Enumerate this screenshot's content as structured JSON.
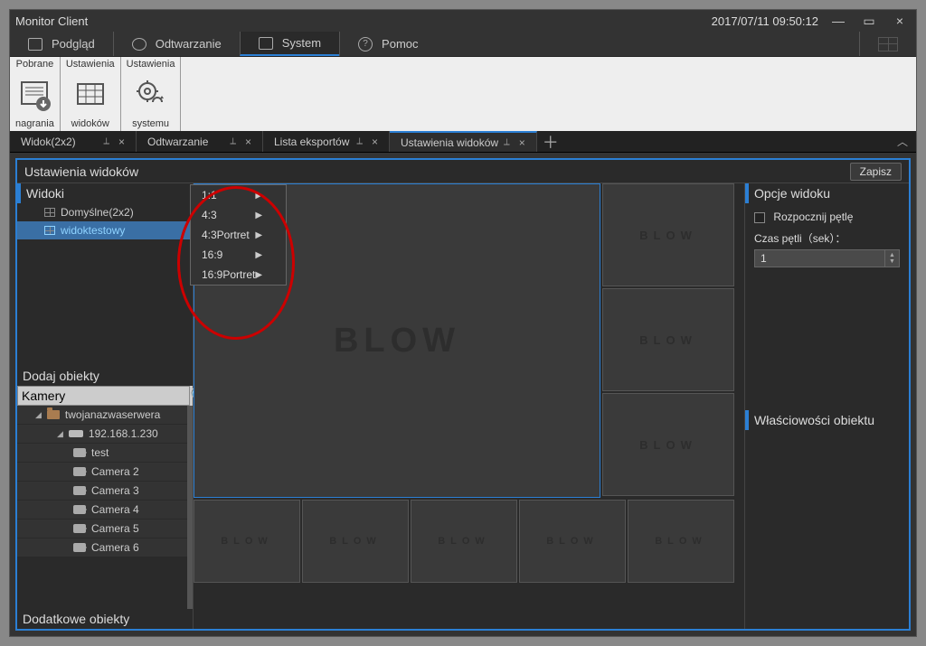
{
  "titlebar": {
    "title": "Monitor Client",
    "datetime": "2017/07/11 09:50:12"
  },
  "mainmenu": {
    "items": [
      {
        "label": "Podgląd"
      },
      {
        "label": "Odtwarzanie"
      },
      {
        "label": "System"
      },
      {
        "label": "Pomoc"
      }
    ]
  },
  "ribbon": {
    "groups": [
      {
        "top": "Pobrane",
        "bottom": "nagrania"
      },
      {
        "top": "Ustawienia",
        "bottom": "widoków"
      },
      {
        "top": "Ustawienia",
        "bottom": "systemu"
      }
    ]
  },
  "subtabs": {
    "items": [
      {
        "label": "Widok(2x2)"
      },
      {
        "label": "Odtwarzanie"
      },
      {
        "label": "Lista eksportów"
      },
      {
        "label": "Ustawienia widoków"
      }
    ]
  },
  "page": {
    "title": "Ustawienia widoków",
    "save_label": "Zapisz"
  },
  "views_panel": {
    "title": "Widoki",
    "items": [
      {
        "label": "Domyślne(2x2)"
      },
      {
        "label": "widoktestowy"
      }
    ]
  },
  "context_menu": {
    "items": [
      {
        "label": "1:1"
      },
      {
        "label": "4:3"
      },
      {
        "label": "4:3Portret"
      },
      {
        "label": "16:9"
      },
      {
        "label": "16:9Portret"
      }
    ]
  },
  "add_objects": {
    "title": "Dodaj obiekty",
    "search_placeholder": "Kamery",
    "extra_title": "Dodatkowe obiekty",
    "tree": {
      "server": "twojanazwaserwera",
      "nvr": "192.168.1.230",
      "cams": [
        "test",
        "Camera 2",
        "Camera 3",
        "Camera 4",
        "Camera 5",
        "Camera 6"
      ]
    }
  },
  "options": {
    "title": "Opcje widoku",
    "loop_label": "Rozpocznij pętlę",
    "loop_time_label": "Czas pętli（sek）：",
    "loop_time_value": "1",
    "props_title": "Właściowości obiektu"
  },
  "blow": "BLOW"
}
